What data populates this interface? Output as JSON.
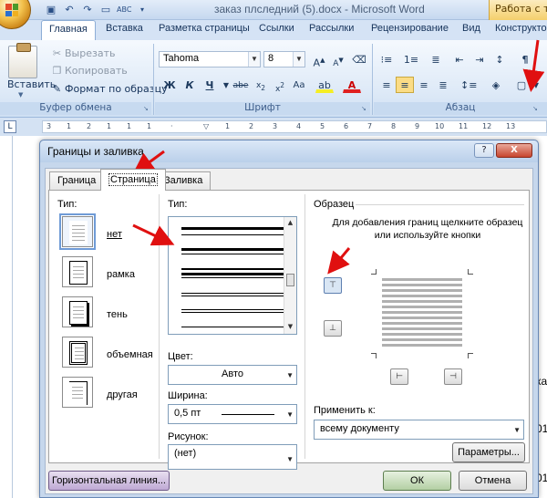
{
  "window": {
    "title": "заказ плследний (5).docx - Microsoft Word",
    "context_tab": "Работа с таб"
  },
  "ribbon": {
    "tabs": [
      "Главная",
      "Вставка",
      "Разметка страницы",
      "Ссылки",
      "Рассылки",
      "Рецензирование",
      "Вид",
      "Конструкто"
    ],
    "clipboard": {
      "paste_label": "Вставить",
      "cut_label": "Вырезать",
      "copy_label": "Копировать",
      "format_painter_label": "Формат по образцу",
      "group_label": "Буфер обмена"
    },
    "font": {
      "font_name": "Tahoma",
      "font_size": "8",
      "group_label": "Шрифт"
    },
    "paragraph": {
      "group_label": "Абзац"
    }
  },
  "document": {
    "line1": "ка",
    "line2": "01",
    "line3": "01"
  },
  "dialog": {
    "title": "Границы и заливка",
    "help_label": "?",
    "close_label": "X",
    "tabs": [
      "Граница",
      "Страница",
      "Заливка"
    ],
    "active_tab": "Страница",
    "setting_label": "Тип:",
    "settings": [
      "нет",
      "рамка",
      "тень",
      "объемная",
      "другая"
    ],
    "style_label": "Тип:",
    "color_label": "Цвет:",
    "color_value": "Авто",
    "width_label": "Ширина:",
    "width_value": "0,5 пт",
    "art_label": "Рисунок:",
    "art_value": "(нет)",
    "preview_label": "Образец",
    "preview_hint": "Для добавления границ щелкните образец или используйте кнопки",
    "apply_label": "Применить к:",
    "apply_value": "всему документу",
    "options_button": "Параметры...",
    "horizontal_line_button": "Горизонтальная линия...",
    "ok_button": "ОК",
    "cancel_button": "Отмена"
  }
}
